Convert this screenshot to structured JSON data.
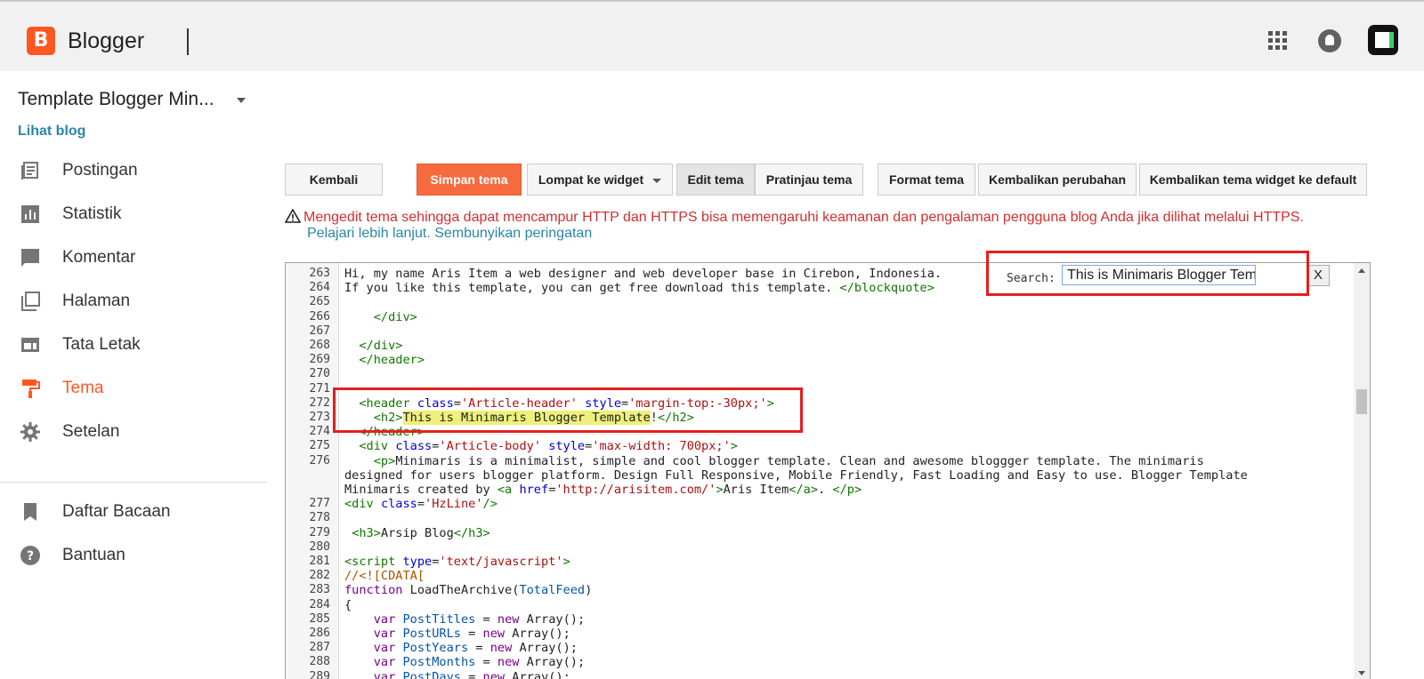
{
  "header": {
    "logo_letter": "B",
    "brand": "Blogger",
    "apps_icon": "grid-icon",
    "notifications_icon": "bell-icon",
    "account_icon": "avatar"
  },
  "sidebar": {
    "blog_title": "Template Blogger Min...",
    "view_blog": "Lihat blog",
    "items": [
      {
        "label": "Postingan",
        "icon": "posts-icon"
      },
      {
        "label": "Statistik",
        "icon": "stats-icon"
      },
      {
        "label": "Komentar",
        "icon": "comments-icon"
      },
      {
        "label": "Halaman",
        "icon": "pages-icon"
      },
      {
        "label": "Tata Letak",
        "icon": "layout-icon"
      },
      {
        "label": "Tema",
        "icon": "theme-icon",
        "active": true
      },
      {
        "label": "Setelan",
        "icon": "settings-icon"
      }
    ],
    "secondary": [
      {
        "label": "Daftar Bacaan",
        "icon": "bookmark-icon"
      },
      {
        "label": "Bantuan",
        "icon": "help-icon"
      }
    ]
  },
  "toolbar": {
    "back": "Kembali",
    "save": "Simpan tema",
    "jump": "Lompat ke widget",
    "edit": "Edit tema",
    "preview": "Pratinjau tema",
    "format": "Format tema",
    "revert": "Kembalikan perubahan",
    "reset_widgets": "Kembalikan tema widget ke default"
  },
  "warning": {
    "text": "Mengedit tema sehingga dapat mencampur HTTP dan HTTPS bisa memengaruhi keamanan dan pengalaman pengguna blog Anda jika dilihat melalui HTTPS.",
    "learn_more": "Pelajari lebih lanjut.",
    "hide": "Sembunyikan peringatan"
  },
  "search": {
    "label": "Search:",
    "value": "This is Minimaris Blogger Template",
    "close": "X"
  },
  "colors": {
    "accent": "#ff5722",
    "link": "#2a86a9",
    "warning": "#d32f2f",
    "highlight_box": "#e51e1e"
  },
  "editor": {
    "lines": [
      {
        "n": "263",
        "html": "Hi, my name Aris Item a web designer and web developer base in Cirebon, Indonesia."
      },
      {
        "n": "264",
        "html": "If you like this template, you can get free download this template. <span class=\"tag\">&lt;/blockquote&gt;</span>"
      },
      {
        "n": "265",
        "html": ""
      },
      {
        "n": "266",
        "html": "    <span class=\"tag\">&lt;/div&gt;</span>"
      },
      {
        "n": "267",
        "html": ""
      },
      {
        "n": "268",
        "html": "  <span class=\"tag\">&lt;/div&gt;</span>"
      },
      {
        "n": "269",
        "html": "  <span class=\"tag\">&lt;/header&gt;</span>"
      },
      {
        "n": "270",
        "html": ""
      },
      {
        "n": "271",
        "html": ""
      },
      {
        "n": "272",
        "html": "  <span class=\"tag\">&lt;header</span> <span class=\"attr\">class</span>=<span class=\"str\">'Article-header'</span> <span class=\"attr\">style</span>=<span class=\"str\">'margin-top:-30px;'</span><span class=\"tag\">&gt;</span>"
      },
      {
        "n": "273",
        "html": "    <span class=\"tag\">&lt;h2&gt;</span><span class=\"hl\">This is Minimaris Blogger Template</span>!<span class=\"tag\">&lt;/h2&gt;</span>"
      },
      {
        "n": "274",
        "html": "  <span class=\"tag\">&lt;/header&gt;</span>"
      },
      {
        "n": "275",
        "html": "  <span class=\"tag\">&lt;div</span> <span class=\"attr\">class</span>=<span class=\"str\">'Article-body'</span> <span class=\"attr\">style</span>=<span class=\"str\">'max-width: 700px;'</span><span class=\"tag\">&gt;</span>"
      },
      {
        "n": "276",
        "html": "    <span class=\"tag\">&lt;p&gt;</span>Minimaris is a minimalist, simple and cool blogger template. Clean and awesome bloggger template. The minimaris"
      },
      {
        "n": "",
        "html": "designed for users blogger platform. Design Full Responsive, Mobile Friendly, Fast Loading and Easy to use. Blogger Template"
      },
      {
        "n": "",
        "html": "Minimaris created by <span class=\"tag\">&lt;a</span> <span class=\"attr\">href</span>=<span class=\"str\">'http://arisitem.com/'</span><span class=\"tag\">&gt;</span>Aris Item<span class=\"tag\">&lt;/a&gt;</span>. <span class=\"tag\">&lt;/p&gt;</span>"
      },
      {
        "n": "277",
        "html": "<span class=\"tag\">&lt;div</span> <span class=\"attr\">class</span>=<span class=\"str\">'HzLine'</span><span class=\"tag\">/&gt;</span>"
      },
      {
        "n": "278",
        "html": ""
      },
      {
        "n": "279",
        "html": " <span class=\"tag\">&lt;h3&gt;</span>Arsip Blog<span class=\"tag\">&lt;/h3&gt;</span>"
      },
      {
        "n": "280",
        "html": ""
      },
      {
        "n": "281",
        "html": "<span class=\"tag\">&lt;script</span> <span class=\"attr\">type</span>=<span class=\"str\">'text/javascript'</span><span class=\"tag\">&gt;</span>"
      },
      {
        "n": "282",
        "html": "<span class=\"cmt\">//&lt;![CDATA[</span>"
      },
      {
        "n": "283",
        "html": "<span class=\"kw\">function</span> LoadTheArchive(<span class=\"var\">TotalFeed</span>)"
      },
      {
        "n": "284",
        "html": "{"
      },
      {
        "n": "285",
        "html": "    <span class=\"kw\">var</span> <span class=\"var\">PostTitles</span> = <span class=\"kw\">new</span> Array();"
      },
      {
        "n": "286",
        "html": "    <span class=\"kw\">var</span> <span class=\"var\">PostURLs</span> = <span class=\"kw\">new</span> Array();"
      },
      {
        "n": "287",
        "html": "    <span class=\"kw\">var</span> <span class=\"var\">PostYears</span> = <span class=\"kw\">new</span> Array();"
      },
      {
        "n": "288",
        "html": "    <span class=\"kw\">var</span> <span class=\"var\">PostMonths</span> = <span class=\"kw\">new</span> Array();"
      },
      {
        "n": "289",
        "html": "    <span class=\"kw\">var</span> <span class=\"var\">PostDays</span> = <span class=\"kw\">new</span> Array();"
      }
    ]
  }
}
